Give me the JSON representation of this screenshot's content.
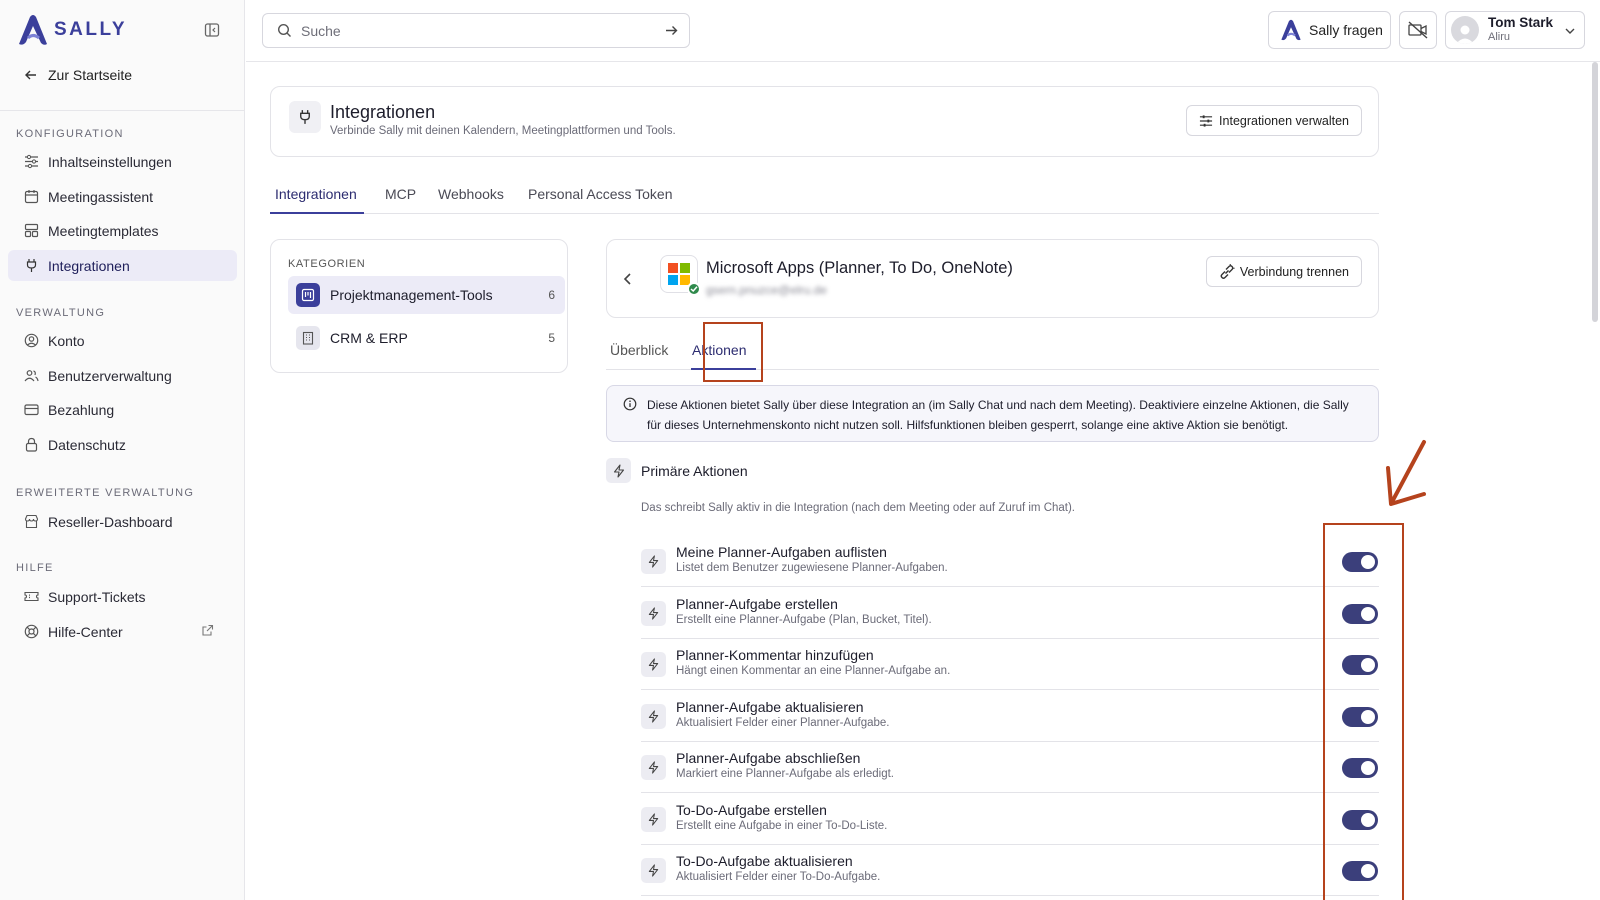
{
  "brand": {
    "logo_text": "SALLY",
    "accent": "#3b3f9b"
  },
  "sidebar": {
    "back_label": "Zur Startseite",
    "sections": [
      {
        "title": "KONFIGURATION",
        "items": [
          {
            "label": "Inhaltseinstellungen",
            "icon": "sliders-icon"
          },
          {
            "label": "Meetingassistent",
            "icon": "calendar-icon"
          },
          {
            "label": "Meetingtemplates",
            "icon": "template-icon"
          },
          {
            "label": "Integrationen",
            "icon": "plug-icon",
            "active": true
          }
        ]
      },
      {
        "title": "VERWALTUNG",
        "items": [
          {
            "label": "Konto",
            "icon": "user-circle-icon"
          },
          {
            "label": "Benutzerverwaltung",
            "icon": "users-icon"
          },
          {
            "label": "Bezahlung",
            "icon": "credit-card-icon"
          },
          {
            "label": "Datenschutz",
            "icon": "lock-icon"
          }
        ]
      },
      {
        "title": "ERWEITERTE VERWALTUNG",
        "items": [
          {
            "label": "Reseller-Dashboard",
            "icon": "store-icon"
          }
        ]
      },
      {
        "title": "HILFE",
        "items": [
          {
            "label": "Support-Tickets",
            "icon": "ticket-icon"
          },
          {
            "label": "Hilfe-Center",
            "icon": "lifebuoy-icon",
            "external": true
          }
        ]
      }
    ]
  },
  "topbar": {
    "search_placeholder": "Suche",
    "ask_sally_label": "Sally fragen",
    "user_name": "Tom Stark",
    "user_org": "Aliru"
  },
  "header": {
    "title": "Integrationen",
    "subtitle": "Verbinde Sally mit deinen Kalendern, Meetingplattformen und Tools.",
    "manage_label": "Integrationen verwalten"
  },
  "main_tabs": [
    "Integrationen",
    "MCP",
    "Webhooks",
    "Personal Access Token"
  ],
  "categories": {
    "title": "KATEGORIEN",
    "items": [
      {
        "label": "Projektmanagement-Tools",
        "count": "6",
        "active": true
      },
      {
        "label": "CRM & ERP",
        "count": "5"
      }
    ]
  },
  "integration": {
    "title": "Microsoft Apps (Planner, To Do, OneNote)",
    "email": "gsern.pnuzce@elru.de",
    "disconnect_label": "Verbindung trennen",
    "logo_colors": [
      "#f25022",
      "#7fba00",
      "#00a4ef",
      "#ffb900"
    ]
  },
  "sub_tabs": [
    "Überblick",
    "Aktionen"
  ],
  "info_text": "Diese Aktionen bietet Sally über diese Integration an (im Sally Chat und nach dem Meeting). Deaktiviere einzelne Aktionen, die Sally für dieses Unternehmenskonto nicht nutzen soll. Hilfsfunktionen bleiben gesperrt, solange eine aktive Aktion sie benötigt.",
  "primary_actions": {
    "title": "Primäre Aktionen",
    "description": "Das schreibt Sally aktiv in die Integration (nach dem Meeting oder auf Zuruf im Chat).",
    "items": [
      {
        "title": "Meine Planner-Aufgaben auflisten",
        "desc": "Listet dem Benutzer zugewiesene Planner-Aufgaben.",
        "enabled": true
      },
      {
        "title": "Planner-Aufgabe erstellen",
        "desc": "Erstellt eine Planner-Aufgabe (Plan, Bucket, Titel).",
        "enabled": true
      },
      {
        "title": "Planner-Kommentar hinzufügen",
        "desc": "Hängt einen Kommentar an eine Planner-Aufgabe an.",
        "enabled": true
      },
      {
        "title": "Planner-Aufgabe aktualisieren",
        "desc": "Aktualisiert Felder einer Planner-Aufgabe.",
        "enabled": true
      },
      {
        "title": "Planner-Aufgabe abschließen",
        "desc": "Markiert eine Planner-Aufgabe als erledigt.",
        "enabled": true
      },
      {
        "title": "To-Do-Aufgabe erstellen",
        "desc": "Erstellt eine Aufgabe in einer To-Do-Liste.",
        "enabled": true
      },
      {
        "title": "To-Do-Aufgabe aktualisieren",
        "desc": "Aktualisiert Felder einer To-Do-Aufgabe.",
        "enabled": true
      }
    ]
  }
}
